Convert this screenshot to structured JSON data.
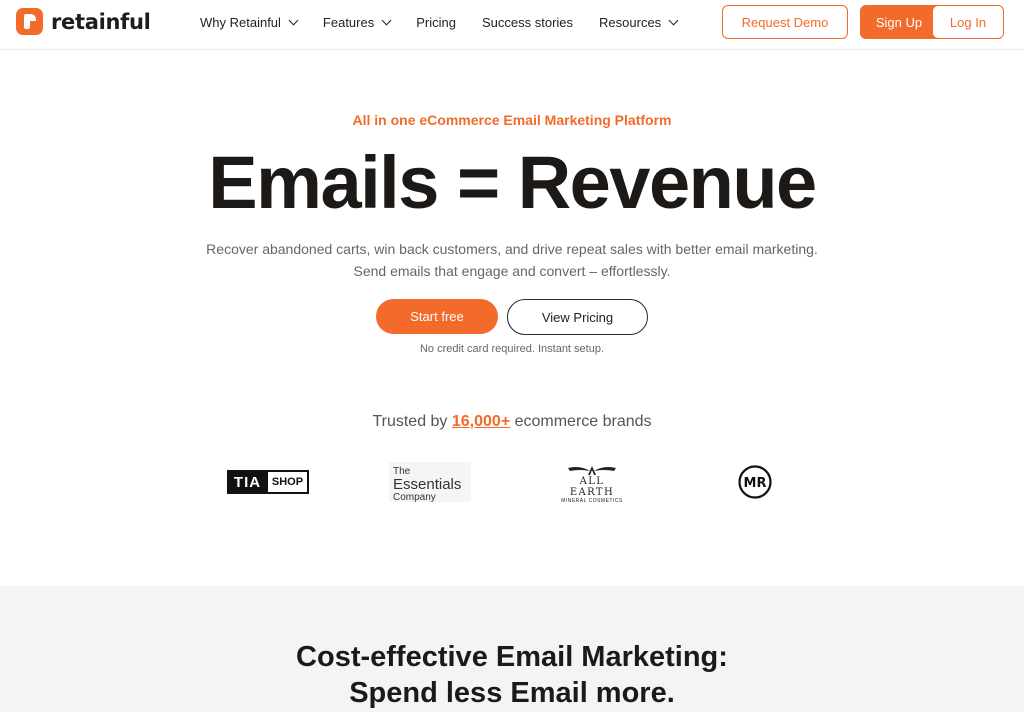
{
  "header": {
    "logo_text": "retainful",
    "nav": [
      {
        "label": "Why Retainful",
        "dropdown": true
      },
      {
        "label": "Features",
        "dropdown": true
      },
      {
        "label": "Pricing",
        "dropdown": false
      },
      {
        "label": "Success stories",
        "dropdown": false
      },
      {
        "label": "Resources",
        "dropdown": true
      }
    ],
    "request_demo_label": "Request Demo",
    "signup_label": "Sign Up",
    "login_label": "Log In"
  },
  "hero": {
    "eyebrow": "All in one eCommerce Email Marketing Platform",
    "title": "Emails = Revenue",
    "subtitle_line1": "Recover abandoned carts, win back customers, and drive repeat sales with better email marketing.",
    "subtitle_line2": "Send emails that engage and convert – effortlessly.",
    "start_free_label": "Start free",
    "view_pricing_label": "View Pricing",
    "note": "No credit card required. Instant setup."
  },
  "trusted": {
    "prefix": "Trusted by ",
    "count": "16,000+",
    "suffix": " ecommerce brands"
  },
  "brands": {
    "tia_a": "TIA",
    "tia_b": "SHOP",
    "essentials_1": "The",
    "essentials_2": "Essentials",
    "essentials_3": "Company",
    "allearth_name": "ALL EARTH",
    "allearth_sub": "MINERAL COSMETICS",
    "mr": "MR"
  },
  "section2": {
    "line1": "Cost-effective Email Marketing:",
    "line2": "Spend less Email more."
  },
  "colors": {
    "accent": "#f26b2a",
    "text_dark": "#1c1917",
    "band_bg": "#f4f4f4"
  }
}
